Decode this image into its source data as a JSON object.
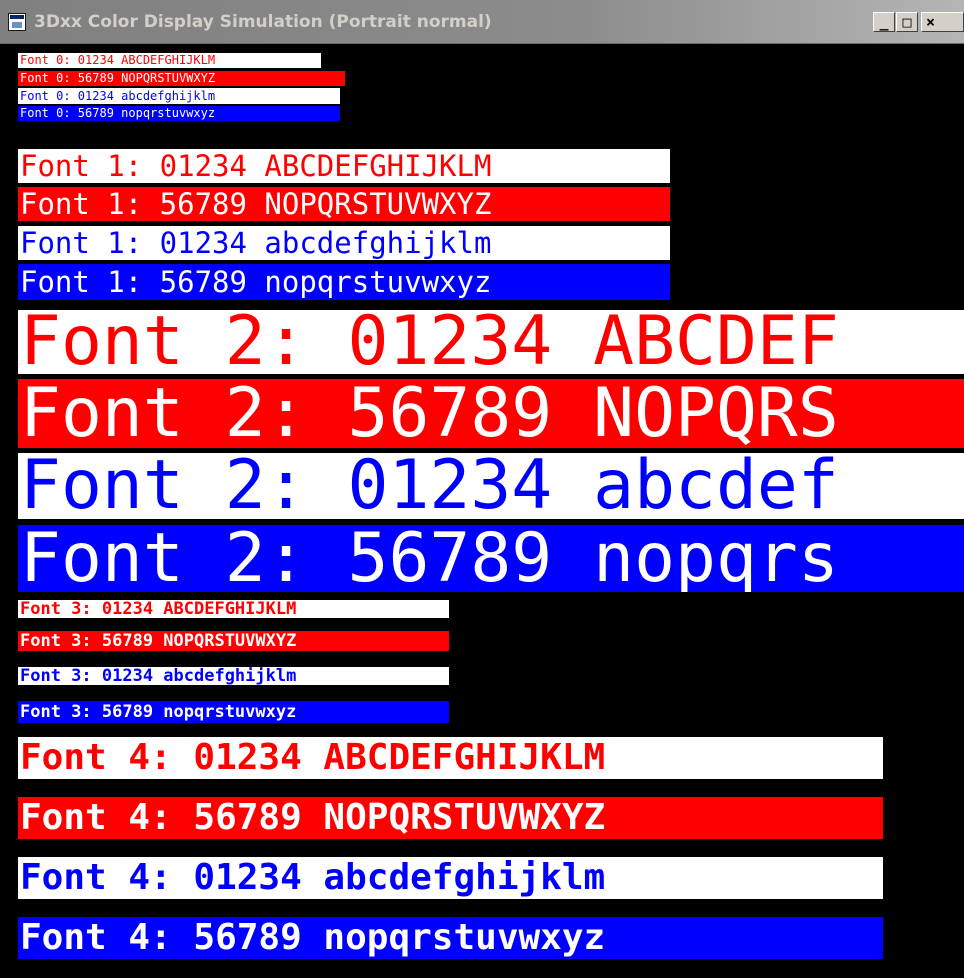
{
  "window": {
    "title": "3Dxx Color Display Simulation (Portrait normal)",
    "icon": "app-window-icon",
    "minimize_label": "_",
    "maximize_label": "□",
    "close_label": "×"
  },
  "colors": {
    "red": "#ff0000",
    "blue": "#0000ff",
    "white": "#ffffff",
    "background": "#000000"
  },
  "font_rows": [
    "Font 0: 01234 ABCDEFGHIJKLM",
    "Font 0: 56789 NOPQRSTUVWXYZ",
    "Font 0: 01234 abcdefghijklm",
    "Font 0: 56789 nopqrstuvwxyz",
    "Font 1: 01234 ABCDEFGHIJKLM",
    "Font 1: 56789 NOPQRSTUVWXYZ",
    "Font 1: 01234 abcdefghijklm",
    "Font 1: 56789 nopqrstuvwxyz",
    "Font 2: 01234 ABCDEF",
    "Font 2: 56789 NOPQRS",
    "Font 2: 01234 abcdef",
    "Font 2: 56789 nopqrs",
    "Font 3: 01234 ABCDEFGHIJKLM",
    "Font 3: 56789 NOPQRSTUVWXYZ",
    "Font 3: 01234 abcdefghijklm",
    "Font 3: 56789 nopqrstuvwxyz",
    "Font 4: 01234 ABCDEFGHIJKLM",
    "Font 4: 56789 NOPQRSTUVWXYZ",
    "Font 4: 01234 abcdefghijklm",
    "Font 4: 56789 nopqrstuvwxyz"
  ]
}
